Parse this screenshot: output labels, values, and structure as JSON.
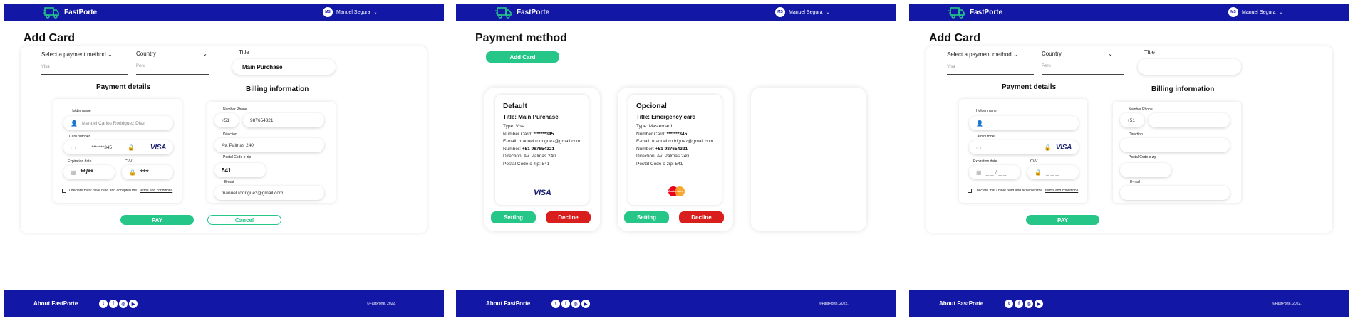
{
  "brand": {
    "name": "FastPorte",
    "accent": "#1317a6",
    "green": "#26c689",
    "red": "#d91e1e"
  },
  "user": {
    "initials": "MS",
    "name": "Manuel Segura"
  },
  "footer": {
    "about": "About FastPorte",
    "copyright": "©FastPorte, 2022.",
    "socials": [
      "twitter-icon",
      "facebook-icon",
      "instagram-icon",
      "youtube-icon"
    ]
  },
  "screen1": {
    "title": "Add Card",
    "payment_method": {
      "label": "Select a payment method",
      "value": "Visa"
    },
    "country": {
      "label": "Country",
      "value": "Peru"
    },
    "title_field": {
      "label": "Title",
      "value": "Main Purchase"
    },
    "payment_details": "Payment details",
    "billing_information": "Billing information",
    "holder_name_label": "Holder name",
    "holder_name": "Manuel Carlos Rodriguez Diaz",
    "card_number_label": "Card number",
    "card_number": "*******345",
    "card_brand": "VISA",
    "expiration_label": "Expiration date",
    "expiration": "**/**",
    "cvv_label": "CVV",
    "cvv": "***",
    "phone_label": "Number Phone",
    "phone_prefix": "+51",
    "phone": "987654321",
    "direction_label": "Direction",
    "direction": "Av. Palmas 240",
    "postal_label": "Postal Code o zip",
    "postal": "541",
    "email_label": "E-mail",
    "email": "manuel.rodriguez@gmail.com",
    "terms_prefix": "I declare that I have read and accepted the",
    "terms_link": "terms and conditions",
    "pay": "PAY",
    "cancel": "Cancel"
  },
  "screen2": {
    "title": "Payment method",
    "add_card": "Add Card",
    "cards": [
      {
        "heading": "Default",
        "title": "Title: Main Purchase",
        "type": "Type: Visa",
        "number_label": "Number Card:",
        "number": "*******345",
        "email": "E-mail: manuel.rodriguez@gmail.com",
        "phone_label": "Number:",
        "phone": "+51 987654321",
        "direction": "Direction: Av. Palmas 240",
        "postal": "Postal Code o zip: 541",
        "brand": "VISA",
        "setting": "Setting",
        "decline": "Decline"
      },
      {
        "heading": "Opcional",
        "title": "Title:  Emergency card",
        "type": "Type: Mastercard",
        "number_label": "Number Card:",
        "number": "*******345",
        "email": "E-mail: manuel.rodriguez@gmail.com",
        "phone_label": "Number:",
        "phone": "+51 987654321",
        "direction": "Direction: Av. Palmas 240",
        "postal": "Postal Code o zip: 541",
        "brand": "MasterCard",
        "setting": "Setting",
        "decline": "Decline"
      }
    ]
  },
  "screen3": {
    "title": "Add Card",
    "payment_method": {
      "label": "Select a payment method",
      "value": "Visa"
    },
    "country": {
      "label": "Country",
      "value": "Peru"
    },
    "title_field": {
      "label": "Title",
      "value": ""
    },
    "payment_details": "Payment details",
    "billing_information": "Billing information",
    "holder_name_label": "Holder name",
    "card_number_label": "Card number",
    "card_brand": "VISA",
    "expiration_label": "Expiration date",
    "expiration_placeholder": "_ _ / _ _",
    "cvv_label": "CVV",
    "cvv_placeholder": "_ _ _",
    "phone_label": "Number Phone",
    "phone_prefix": "+51",
    "direction_label": "Direction",
    "postal_label": "Postal Code o zip",
    "email_label": "E-mail",
    "terms_prefix": "I declare that I have read and accepted the",
    "terms_link": "terms and conditions",
    "pay": "PAY"
  }
}
